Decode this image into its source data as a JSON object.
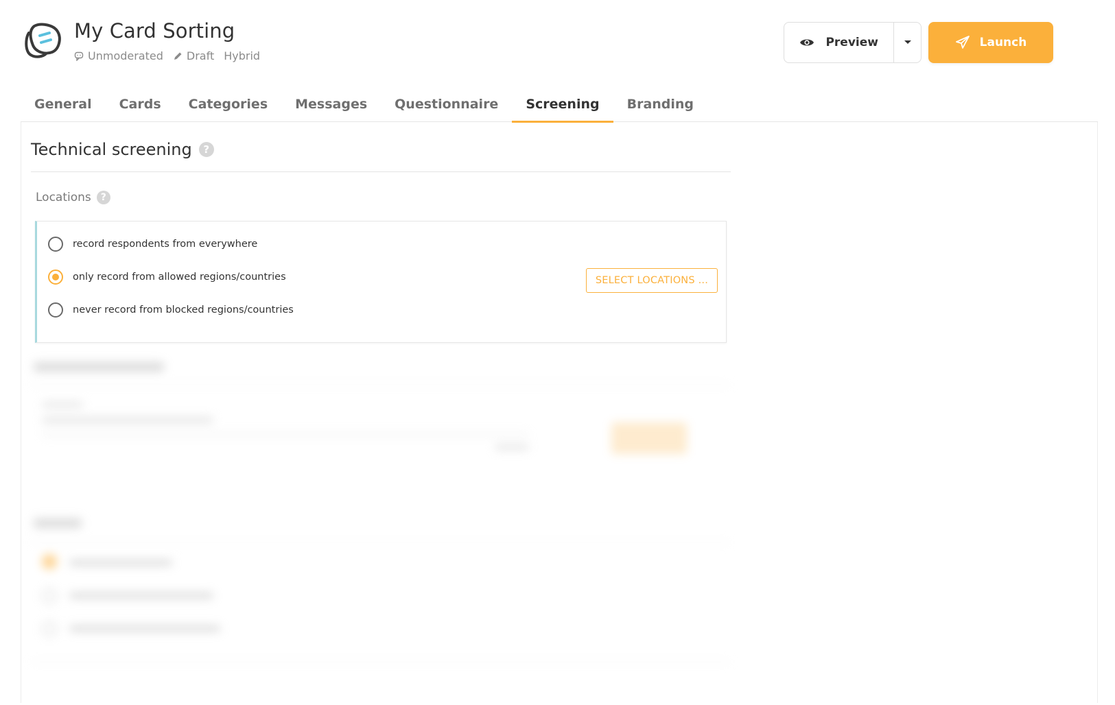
{
  "header": {
    "title": "My Card Sorting",
    "meta": {
      "mode": "Unmoderated",
      "status": "Draft",
      "type": "Hybrid"
    },
    "preview_label": "Preview",
    "launch_label": "Launch"
  },
  "tabs": [
    {
      "label": "General",
      "active": false
    },
    {
      "label": "Cards",
      "active": false
    },
    {
      "label": "Categories",
      "active": false
    },
    {
      "label": "Messages",
      "active": false
    },
    {
      "label": "Questionnaire",
      "active": false
    },
    {
      "label": "Screening",
      "active": true
    },
    {
      "label": "Branding",
      "active": false
    }
  ],
  "screening": {
    "title": "Technical screening",
    "help_glyph": "?",
    "locations": {
      "label": "Locations",
      "options": [
        {
          "label": "record respondents from everywhere",
          "checked": false
        },
        {
          "label": "only record from allowed regions/countries",
          "checked": true
        },
        {
          "label": "never record from blocked regions/countries",
          "checked": false
        }
      ],
      "select_button": "SELECT LOCATIONS ..."
    }
  },
  "colors": {
    "accent": "#fbb03b",
    "highlight_border": "#a8d9de",
    "logo_accent": "#5bc0de"
  }
}
